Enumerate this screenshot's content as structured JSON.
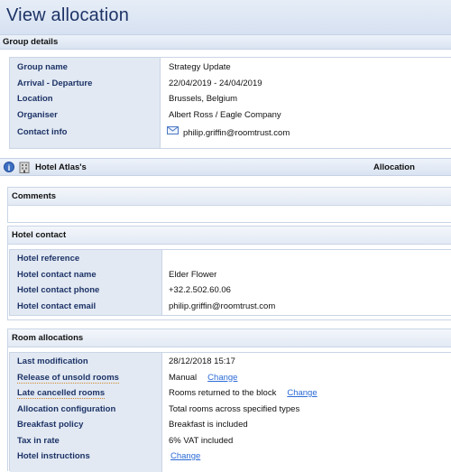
{
  "page": {
    "title": "View allocation"
  },
  "group_details": {
    "header": "Group details",
    "rows": [
      {
        "label": "Group name",
        "value": "Strategy Update"
      },
      {
        "label": "Arrival - Departure",
        "value": "22/04/2019 - 24/04/2019"
      },
      {
        "label": "Location",
        "value": "Brussels, Belgium"
      },
      {
        "label": "Organiser",
        "value": "Albert Ross / Eagle Company"
      },
      {
        "label": "Contact info",
        "value": "philip.griffin@roomtrust.com",
        "icon": "envelope-icon"
      }
    ]
  },
  "hotel_bar": {
    "hotel_name": "Hotel Atlas's",
    "allocation_label": "Allocation",
    "icons": [
      "info-icon",
      "hotel-building-icon"
    ]
  },
  "comments": {
    "header": "Comments"
  },
  "hotel_contact": {
    "header": "Hotel contact",
    "rows": [
      {
        "label": "Hotel reference",
        "value": ""
      },
      {
        "label": "Hotel contact name",
        "value": "Elder Flower"
      },
      {
        "label": "Hotel contact phone",
        "value": "+32.2.502.60.06"
      },
      {
        "label": "Hotel contact email",
        "value": "philip.griffin@roomtrust.com"
      }
    ]
  },
  "room_allocations": {
    "header": "Room allocations",
    "rows": [
      {
        "label": "Last modification",
        "value": "28/12/2018 15:17"
      },
      {
        "label": "Release of unsold rooms",
        "value": "Manual",
        "link": "Change"
      },
      {
        "label": "Late cancelled rooms",
        "value": "Rooms returned to the block",
        "link": "Change"
      },
      {
        "label": "Allocation configuration",
        "value": "Total rooms across specified types"
      },
      {
        "label": "Breakfast policy",
        "value": "Breakfast is included"
      },
      {
        "label": "Tax in rate",
        "value": "6% VAT included"
      },
      {
        "label": "Hotel instructions",
        "value": "",
        "link": "Change"
      }
    ]
  },
  "colors": {
    "label_text": "#1d3366",
    "link": "#2a6ad6",
    "label_bg": "#e2e9f3"
  }
}
